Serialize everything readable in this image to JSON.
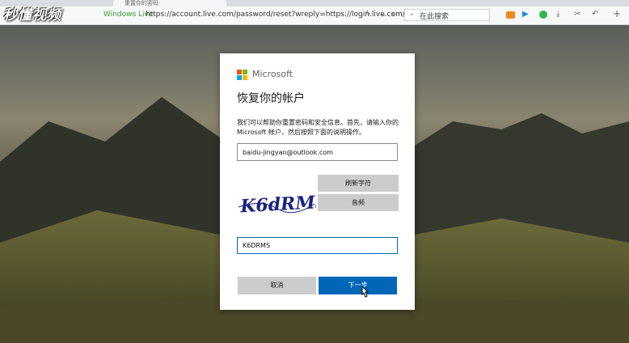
{
  "browser": {
    "tab_title": "重置你的密码",
    "site_name": "Windows Live",
    "url": "https://account.live.com/password/reset?wreply=https://login.live.com/",
    "search_placeholder": "在此搜索",
    "icons": [
      "back-icon",
      "lightning-icon",
      "chevron-down-icon",
      "search-icon",
      "video-icon",
      "play-icon",
      "chat-icon",
      "download-icon",
      "scissors-icon",
      "undo-icon",
      "add-icon"
    ]
  },
  "watermark": "秒懂视频",
  "dialog": {
    "brand": "Microsoft",
    "title": "恢复你的帐户",
    "description": "我们可以帮助你重置密码和安全信息。首先，请输入你的 Microsoft 帐户，然后按照下面的说明操作。",
    "email_value": "baidu-jingyan@outlook.com",
    "captcha_text": "K6dRMS",
    "refresh_label": "刷新字符",
    "audio_label": "音频",
    "captcha_input_value": "K6DRMS",
    "cancel_label": "取消",
    "next_label": "下一步",
    "colors": {
      "accent": "#0067b8",
      "ms_red": "#f25022",
      "ms_green": "#7fba00",
      "ms_blue": "#00a4ef",
      "ms_yellow": "#ffb900"
    }
  }
}
